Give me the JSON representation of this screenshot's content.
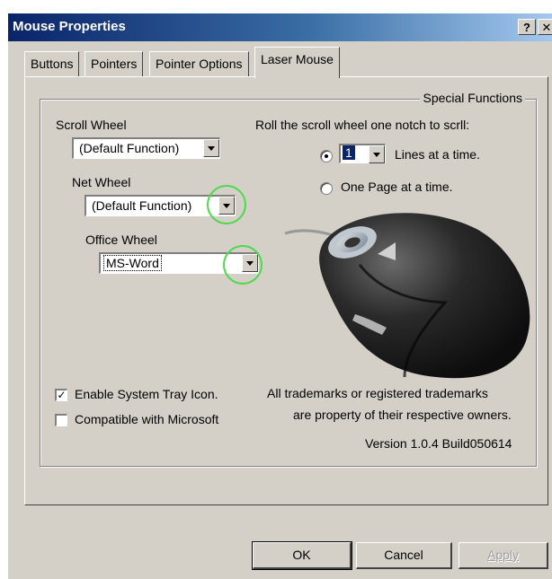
{
  "window": {
    "title": "Mouse Properties",
    "help_button": "?",
    "close_button": "✕"
  },
  "tabs": [
    "Buttons",
    "Pointers",
    "Pointer Options",
    "Laser Mouse"
  ],
  "active_tab": "Laser Mouse",
  "panel": {
    "group_title": "Special Functions",
    "scroll_wheel": {
      "label": "Scroll Wheel",
      "value": "(Default Function)"
    },
    "net_wheel": {
      "label": "Net Wheel",
      "value": "(Default Function)"
    },
    "office_wheel": {
      "label": "Office Wheel",
      "value": "MS-Word"
    },
    "scroll_heading": "Roll the scroll wheel one notch to scrll:",
    "lines_option": {
      "value": "1",
      "suffix": "Lines at a time.",
      "checked": true
    },
    "page_option": {
      "label": "One Page at a time.",
      "checked": false
    },
    "system_tray": {
      "label": "Enable System Tray Icon.",
      "checked": true
    },
    "compatible": {
      "label": "Compatible with Microsoft",
      "checked": false
    },
    "trademark_line1": "All trademarks or registered trademarks",
    "trademark_line2": "are property of their respective owners.",
    "version": "Version 1.0.4 Build050614"
  },
  "buttons": {
    "ok": "OK",
    "cancel": "Cancel",
    "apply": "Apply"
  },
  "colors": {
    "titlebar": "#0a246a",
    "dialog_bg": "#d4d0c8",
    "highlight_ring": "#4cd94c"
  }
}
